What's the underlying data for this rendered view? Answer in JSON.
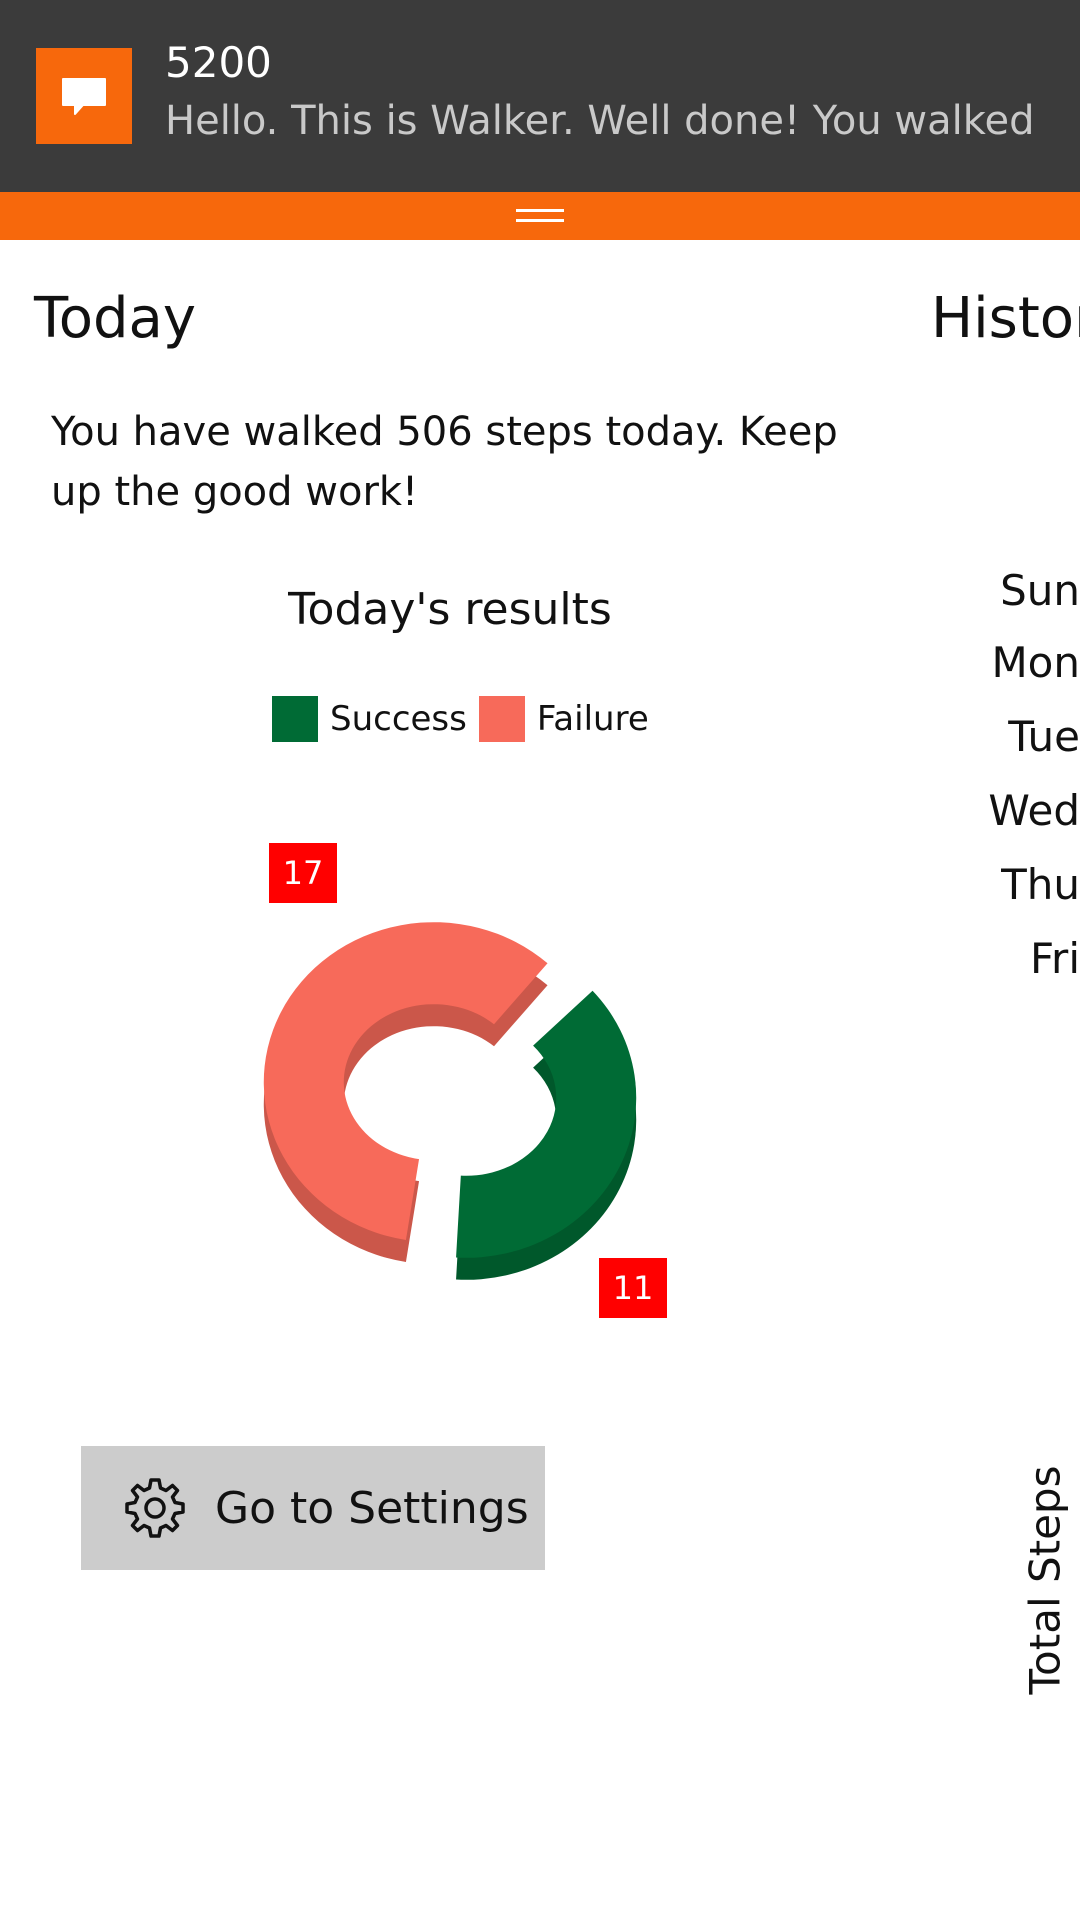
{
  "toast": {
    "title": "5200",
    "message": "Hello. This is Walker. Well done! You walked",
    "icon": "message-icon"
  },
  "colors": {
    "accent": "#f7680c",
    "toast_bg": "#3b3b3b",
    "success": "#006b35",
    "failure": "#f76a5a",
    "data_label_bg": "#ff0000",
    "button_bg": "#cccccc"
  },
  "today": {
    "title": "Today",
    "summary": "You have walked 506 steps today. Keep up the good work!",
    "chart_title": "Today's results"
  },
  "chart_data": {
    "type": "pie",
    "style": "3d-donut",
    "title": "Today's results",
    "legend": [
      "Success",
      "Failure"
    ],
    "legend_placement": "top",
    "slices": [
      {
        "name": "Success",
        "value": 11,
        "color": "#006b35"
      },
      {
        "name": "Failure",
        "value": 17,
        "color": "#f76a5a"
      }
    ]
  },
  "settings_button": {
    "label": "Go to Settings",
    "icon": "gear-icon"
  },
  "history": {
    "title": "Histor",
    "days": [
      "Sun",
      "Mon",
      "Tue",
      "Wed",
      "Thu",
      "Fri"
    ],
    "yaxis_label": "Total Steps"
  }
}
